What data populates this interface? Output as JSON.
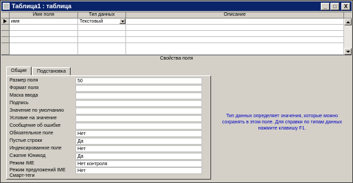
{
  "window": {
    "title": "Таблица1 : таблица",
    "buttons": [
      "_",
      "□",
      "X"
    ]
  },
  "grid": {
    "columns": [
      "Имя поля",
      "Тип данных",
      "Описание"
    ],
    "rows": [
      {
        "name": "имя",
        "type": "Текстовый",
        "description": ""
      },
      {
        "name": "",
        "type": "",
        "description": ""
      },
      {
        "name": "",
        "type": "",
        "description": ""
      },
      {
        "name": "",
        "type": "",
        "description": ""
      },
      {
        "name": "",
        "type": "",
        "description": ""
      }
    ]
  },
  "properties": {
    "section_label": "Свойства поля",
    "tabs": [
      "Общие",
      "Подстановка"
    ],
    "active_tab": "Общие",
    "rows": [
      {
        "label": "Размер поля",
        "value": "50"
      },
      {
        "label": "Формат поля",
        "value": ""
      },
      {
        "label": "Маска ввода",
        "value": ""
      },
      {
        "label": "Подпись",
        "value": ""
      },
      {
        "label": "Значение по умолчанию",
        "value": ""
      },
      {
        "label": "Условие на значение",
        "value": ""
      },
      {
        "label": "Сообщение об ошибке",
        "value": ""
      },
      {
        "label": "Обязательное поле",
        "value": "Нет"
      },
      {
        "label": "Пустые строки",
        "value": "Да"
      },
      {
        "label": "Индексированное поле",
        "value": "Нет"
      },
      {
        "label": "Сжатие Юникод",
        "value": "Да"
      },
      {
        "label": "Режим IME",
        "value": "Нет контроля"
      },
      {
        "label": "Режим предложений IME",
        "value": "Нет"
      },
      {
        "label": "Смарт-теги",
        "value": ""
      }
    ]
  },
  "hint": "Тип данных определяет значения, которые можно сохранять в этом поле. Для справки по типам данных нажмите клавишу F1."
}
